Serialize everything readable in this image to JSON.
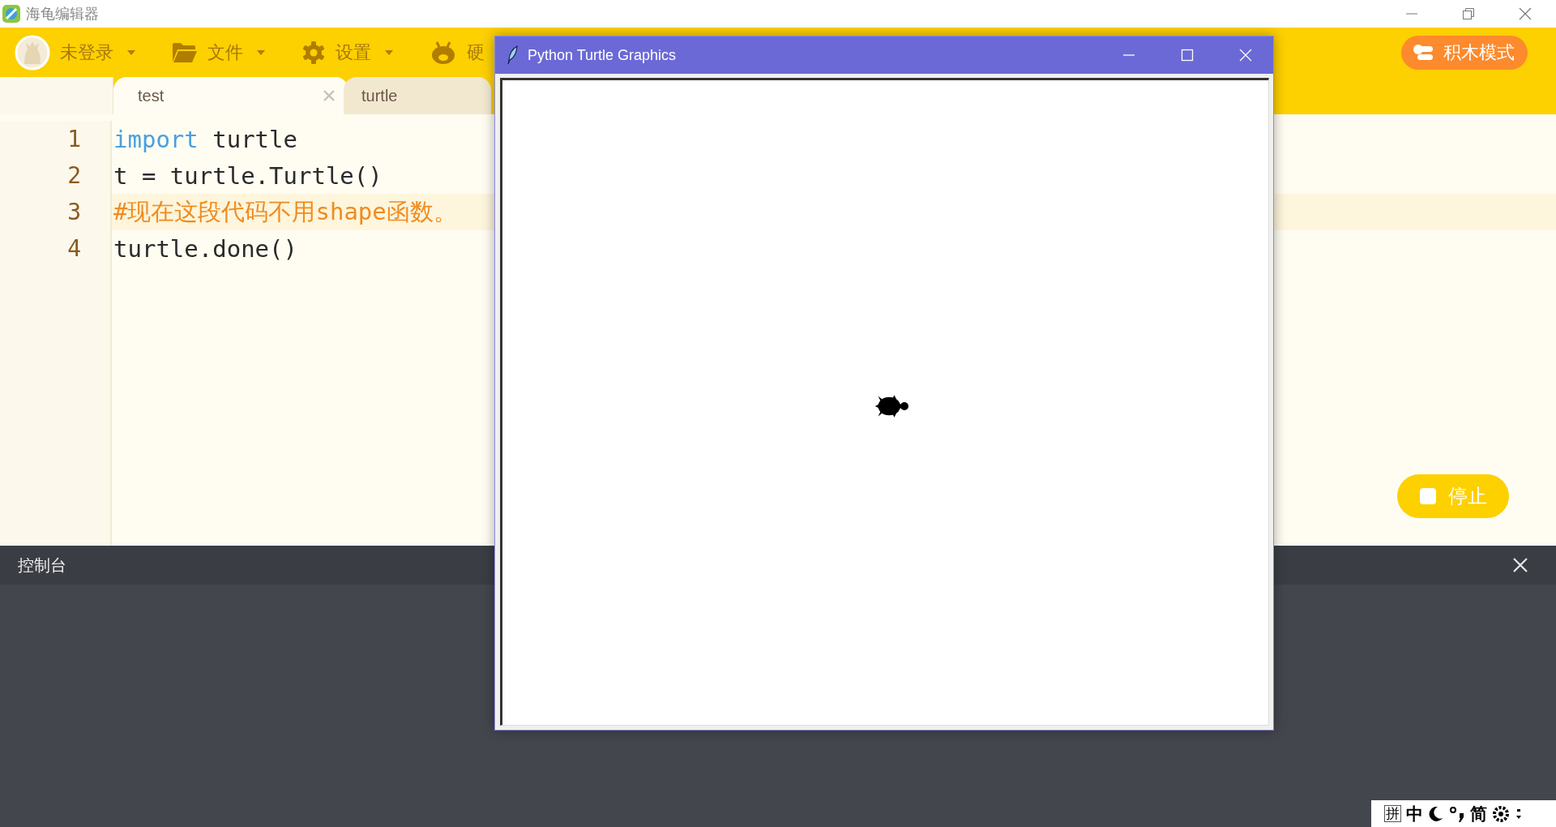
{
  "app": {
    "title": "海龟编辑器"
  },
  "toolbar": {
    "user": {
      "label": "未登录"
    },
    "menus": [
      {
        "label": "文件",
        "kind": "folder"
      },
      {
        "label": "设置",
        "kind": "gear"
      },
      {
        "label": "硬",
        "kind": "robot"
      }
    ],
    "mode_button": "积木模式"
  },
  "tabs": [
    {
      "label": "test",
      "selected": true,
      "closable": true
    },
    {
      "label": "turtle",
      "selected": false,
      "closable": false
    }
  ],
  "editor": {
    "lines": [
      {
        "number": "1",
        "current": false,
        "tokens": [
          {
            "kind": "keyword",
            "text": "import"
          },
          {
            "kind": "plain",
            "text": " turtle"
          }
        ]
      },
      {
        "number": "2",
        "current": false,
        "tokens": [
          {
            "kind": "plain",
            "text": "t = turtle.Turtle()"
          }
        ]
      },
      {
        "number": "3",
        "current": true,
        "tokens": [
          {
            "kind": "comment",
            "text": "#现在这段代码不用shape函数。"
          }
        ]
      },
      {
        "number": "4",
        "current": false,
        "tokens": [
          {
            "kind": "plain",
            "text": "turtle.done()"
          }
        ]
      }
    ]
  },
  "stop_button": "停止",
  "console": {
    "title": "控制台"
  },
  "turtle_window": {
    "title": "Python Turtle Graphics"
  },
  "ime_bar": {
    "items": [
      {
        "kind": "boxed",
        "text": "拼"
      },
      {
        "kind": "text",
        "text": "中"
      },
      {
        "kind": "moon"
      },
      {
        "kind": "punct"
      },
      {
        "kind": "text",
        "text": "简"
      },
      {
        "kind": "gear"
      },
      {
        "kind": "more"
      }
    ]
  }
}
